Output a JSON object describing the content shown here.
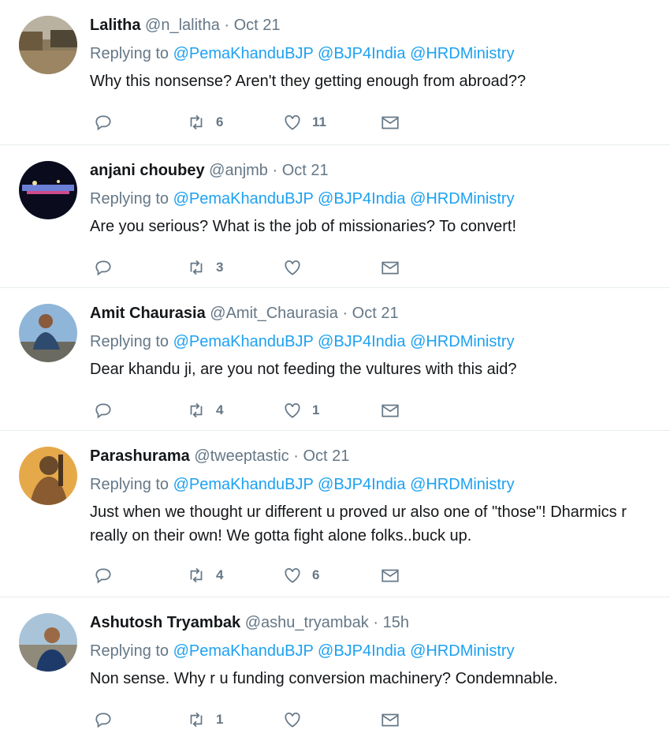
{
  "tweets": [
    {
      "name": "Lalitha",
      "handle": "@n_lalitha",
      "time": "Oct 21",
      "replying_prefix": "Replying to",
      "mentions": [
        "@PemaKhanduBJP",
        "@BJP4India",
        "@HRDMinistry"
      ],
      "text": "Why this nonsense? Aren't they getting enough from abroad??",
      "retweets": "6",
      "likes": "11"
    },
    {
      "name": "anjani choubey",
      "handle": "@anjmb",
      "time": "Oct 21",
      "replying_prefix": "Replying to",
      "mentions": [
        "@PemaKhanduBJP",
        "@BJP4India",
        "@HRDMinistry"
      ],
      "text": "Are you serious? What is the job of missionaries? To convert!",
      "retweets": "3",
      "likes": ""
    },
    {
      "name": "Amit Chaurasia",
      "handle": "@Amit_Chaurasia",
      "time": "Oct 21",
      "replying_prefix": "Replying to",
      "mentions": [
        "@PemaKhanduBJP",
        "@BJP4India",
        "@HRDMinistry"
      ],
      "text": "Dear khandu ji, are you not feeding the vultures with this aid?",
      "retweets": "4",
      "likes": "1"
    },
    {
      "name": "Parashurama",
      "handle": "@tweeptastic",
      "time": "Oct 21",
      "replying_prefix": "Replying to",
      "mentions": [
        "@PemaKhanduBJP",
        "@BJP4India",
        "@HRDMinistry"
      ],
      "text": "Just when we thought ur different u proved ur also one of \"those\"! Dharmics r really on their own! We gotta fight alone folks..buck up.",
      "retweets": "4",
      "likes": "6"
    },
    {
      "name": "Ashutosh Tryambak",
      "handle": "@ashu_tryambak",
      "time": "15h",
      "replying_prefix": "Replying to",
      "mentions": [
        "@PemaKhanduBJP",
        "@BJP4India",
        "@HRDMinistry"
      ],
      "text": "Non sense. Why r u funding conversion machinery? Condemnable.",
      "retweets": "1",
      "likes": ""
    }
  ],
  "dot": "·",
  "icons": {
    "reply": "reply-icon",
    "retweet": "retweet-icon",
    "like": "heart-icon",
    "dm": "envelope-icon"
  },
  "colors": {
    "link": "#1da1f2",
    "muted": "#657786",
    "text": "#14171a",
    "divider": "#e6ecf0"
  }
}
